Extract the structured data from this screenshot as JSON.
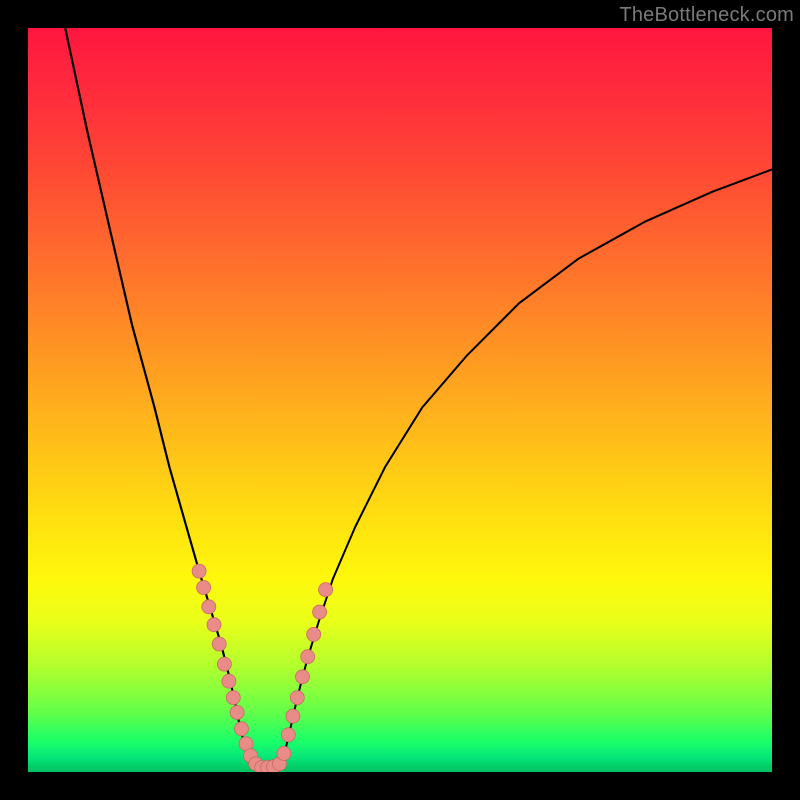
{
  "watermark": "TheBottleneck.com",
  "colors": {
    "curve_stroke": "#000000",
    "point_fill": "#e98b86",
    "point_stroke": "#c96a65"
  },
  "chart_data": {
    "type": "line",
    "title": "",
    "xlabel": "",
    "ylabel": "",
    "xlim": [
      0,
      100
    ],
    "ylim": [
      0,
      100
    ],
    "grid": false,
    "legend": false,
    "series": [
      {
        "name": "curve-left",
        "x": [
          5,
          8,
          11,
          14,
          17,
          19,
          21,
          23,
          24.5,
          26,
          27,
          27.8,
          28.4,
          29,
          29.5,
          30
        ],
        "y": [
          100,
          86,
          73,
          60,
          49,
          41,
          34,
          27,
          22,
          17,
          13,
          9.5,
          6.5,
          4,
          2,
          0.5
        ]
      },
      {
        "name": "curve-right",
        "x": [
          34,
          34.6,
          35.3,
          36.2,
          37.5,
          39,
          41,
          44,
          48,
          53,
          59,
          66,
          74,
          83,
          92,
          100
        ],
        "y": [
          0.5,
          3,
          6,
          10,
          15,
          20,
          26,
          33,
          41,
          49,
          56,
          63,
          69,
          74,
          78,
          81
        ]
      },
      {
        "name": "valley-floor",
        "x": [
          30,
          31,
          32,
          33,
          34
        ],
        "y": [
          0.5,
          0.2,
          0.2,
          0.2,
          0.5
        ]
      }
    ],
    "points": [
      {
        "x": 23.0,
        "y": 27.0
      },
      {
        "x": 23.6,
        "y": 24.8
      },
      {
        "x": 24.3,
        "y": 22.2
      },
      {
        "x": 25.0,
        "y": 19.8
      },
      {
        "x": 25.7,
        "y": 17.2
      },
      {
        "x": 26.4,
        "y": 14.5
      },
      {
        "x": 27.0,
        "y": 12.2
      },
      {
        "x": 27.6,
        "y": 10.0
      },
      {
        "x": 28.1,
        "y": 8.0
      },
      {
        "x": 28.7,
        "y": 5.8
      },
      {
        "x": 29.3,
        "y": 3.8
      },
      {
        "x": 29.9,
        "y": 2.2
      },
      {
        "x": 30.6,
        "y": 1.1
      },
      {
        "x": 31.4,
        "y": 0.6
      },
      {
        "x": 32.2,
        "y": 0.6
      },
      {
        "x": 33.0,
        "y": 0.7
      },
      {
        "x": 33.8,
        "y": 1.1
      },
      {
        "x": 34.4,
        "y": 2.5
      },
      {
        "x": 35.0,
        "y": 5.0
      },
      {
        "x": 35.6,
        "y": 7.5
      },
      {
        "x": 36.2,
        "y": 10.0
      },
      {
        "x": 36.9,
        "y": 12.8
      },
      {
        "x": 37.6,
        "y": 15.5
      },
      {
        "x": 38.4,
        "y": 18.5
      },
      {
        "x": 39.2,
        "y": 21.5
      },
      {
        "x": 40.0,
        "y": 24.5
      }
    ]
  }
}
